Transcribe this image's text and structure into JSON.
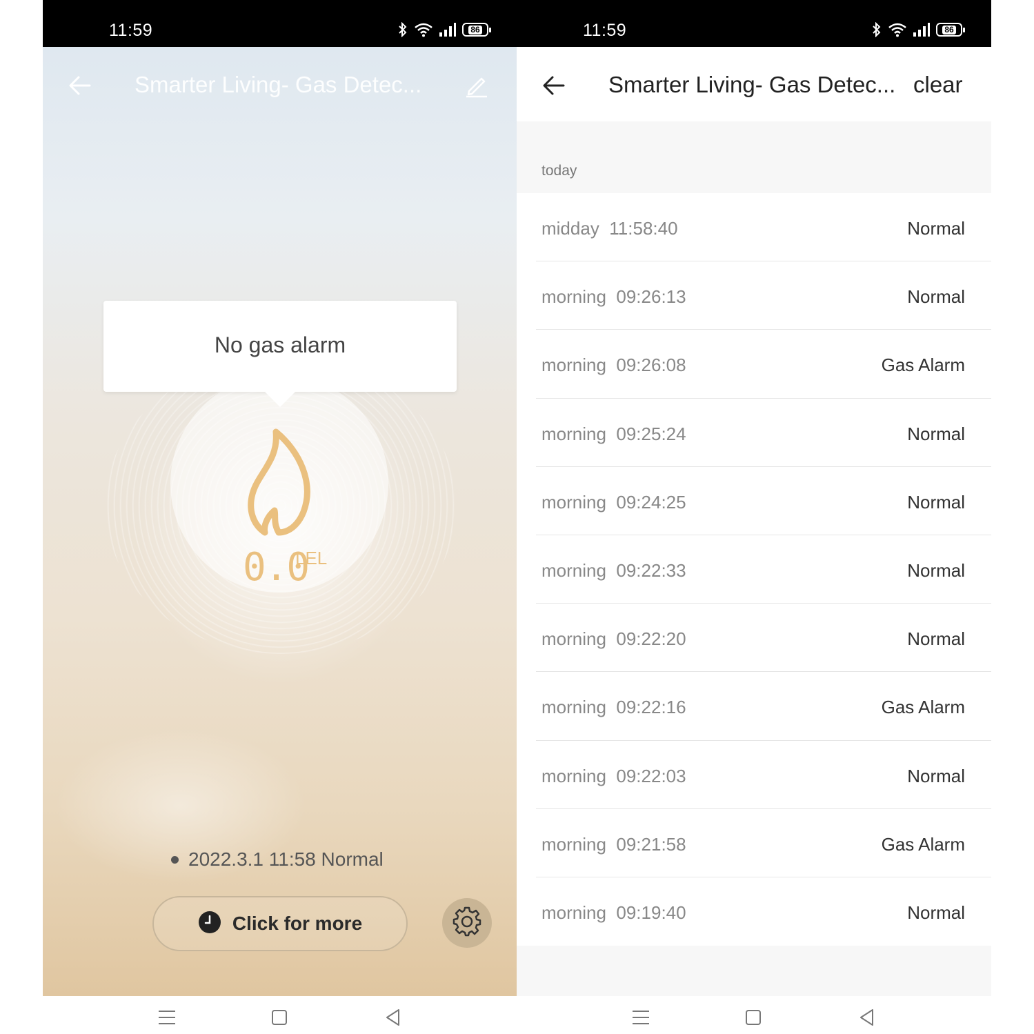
{
  "status_bar": {
    "time": "11:59",
    "battery": "86"
  },
  "left_screen": {
    "title": "Smarter Living- Gas Detec...",
    "alarm_message": "No gas alarm",
    "reading": {
      "value": "0.0",
      "unit": "LEL"
    },
    "last_record": "2022.3.1 11:58 Normal",
    "more_button_label": "Click for more"
  },
  "right_screen": {
    "title": "Smarter Living- Gas Detec...",
    "clear_label": "clear",
    "section_label": "today",
    "records": [
      {
        "period": "midday",
        "time": "11:58:40",
        "status": "Normal"
      },
      {
        "period": "morning",
        "time": "09:26:13",
        "status": "Normal"
      },
      {
        "period": "morning",
        "time": "09:26:08",
        "status": "Gas Alarm"
      },
      {
        "period": "morning",
        "time": "09:25:24",
        "status": "Normal"
      },
      {
        "period": "morning",
        "time": "09:24:25",
        "status": "Normal"
      },
      {
        "period": "morning",
        "time": "09:22:33",
        "status": "Normal"
      },
      {
        "period": "morning",
        "time": "09:22:20",
        "status": "Normal"
      },
      {
        "period": "morning",
        "time": "09:22:16",
        "status": "Gas Alarm"
      },
      {
        "period": "morning",
        "time": "09:22:03",
        "status": "Normal"
      },
      {
        "period": "morning",
        "time": "09:21:58",
        "status": "Gas Alarm"
      },
      {
        "period": "morning",
        "time": "09:19:40",
        "status": "Normal"
      }
    ]
  },
  "colors": {
    "accent": "#eac07f",
    "settings_button": "#c9b595"
  },
  "icons": [
    "bluetooth-icon",
    "wifi-icon",
    "signal-icon",
    "battery-icon",
    "back-arrow-icon",
    "edit-pencil-icon",
    "flame-icon",
    "clock-icon",
    "gear-icon",
    "menu-icon",
    "home-square-icon",
    "back-triangle-icon"
  ]
}
